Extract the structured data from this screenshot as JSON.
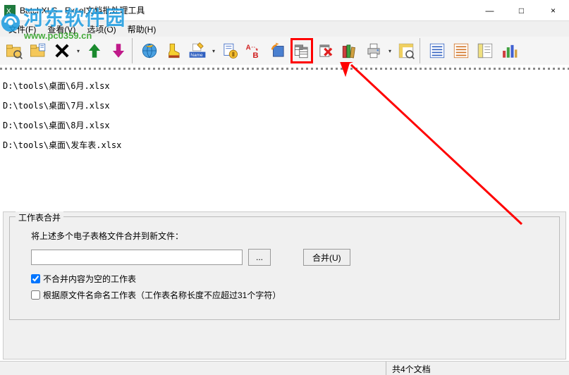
{
  "window": {
    "title": "BatchXLS - Excel文档批处理工具",
    "minimize": "—",
    "maximize": "□",
    "close": "×"
  },
  "menu": {
    "file": "文件(F)",
    "view": "查看(V)",
    "options": "选项(O)",
    "help": "帮助(H)"
  },
  "watermark": {
    "text": "河东软件园",
    "url": "www.pc0359.cn"
  },
  "files": [
    "D:\\tools\\桌面\\6月.xlsx",
    "D:\\tools\\桌面\\7月.xlsx",
    "D:\\tools\\桌面\\8月.xlsx",
    "D:\\tools\\桌面\\发车表.xlsx"
  ],
  "merge_panel": {
    "legend": "工作表合并",
    "instruction": "将上述多个电子表格文件合并到新文件：",
    "output_path": "",
    "browse": "...",
    "merge_btn": "合并(U)",
    "chk_skip_empty": "不合并内容为空的工作表",
    "chk_skip_empty_checked": true,
    "chk_rename": "根据原文件名命名工作表（工作表名称长度不应超过31个字符）",
    "chk_rename_checked": false
  },
  "status": {
    "count": "共4个文档"
  },
  "icons": {
    "open_folder": "open-folder",
    "add_file": "add-file",
    "remove": "remove",
    "up": "up-arrow",
    "down": "down-arrow",
    "ie": "internet",
    "boot": "boot",
    "rename": "rename",
    "attr": "file-attr",
    "ab": "ab-replace",
    "rotate": "rotate",
    "merge_sheets": "merge-sheets",
    "delete_red": "delete-x",
    "books": "books",
    "printer": "printer",
    "pivot": "pivot",
    "list1": "list-blue",
    "list2": "list-orange",
    "list3": "list-pane",
    "chart": "bar-chart"
  }
}
